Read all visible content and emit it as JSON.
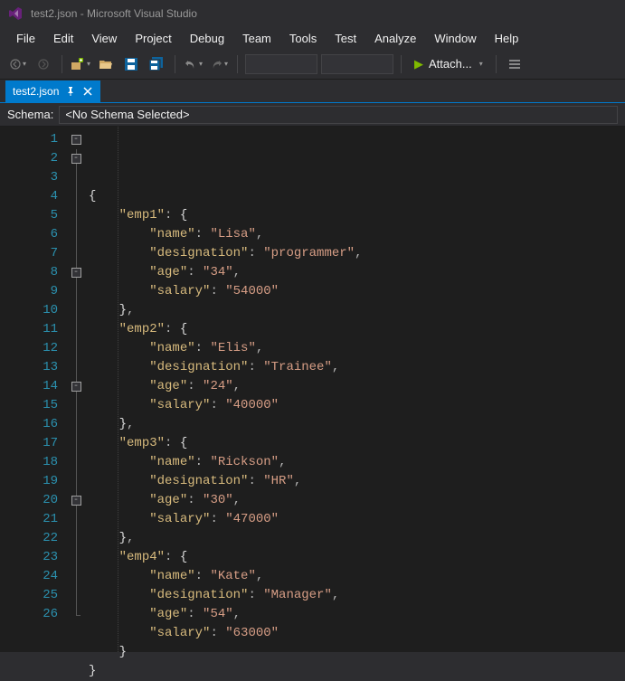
{
  "window": {
    "title": "test2.json - Microsoft Visual Studio"
  },
  "menu": [
    "File",
    "Edit",
    "View",
    "Project",
    "Debug",
    "Team",
    "Tools",
    "Test",
    "Analyze",
    "Window",
    "Help"
  ],
  "toolbar": {
    "attach_label": "Attach..."
  },
  "tab": {
    "label": "test2.json"
  },
  "schema": {
    "label": "Schema:",
    "value": "<No Schema Selected>"
  },
  "code": {
    "lines": 26,
    "content": {
      "emp1": {
        "name": "Lisa",
        "designation": "programmer",
        "age": "34",
        "salary": "54000"
      },
      "emp2": {
        "name": "Elis",
        "designation": "Trainee",
        "age": "24",
        "salary": "40000"
      },
      "emp3": {
        "name": "Rickson",
        "designation": "HR",
        "age": "30",
        "salary": "47000"
      },
      "emp4": {
        "name": "Kate",
        "designation": "Manager",
        "age": "54",
        "salary": "63000"
      }
    }
  }
}
